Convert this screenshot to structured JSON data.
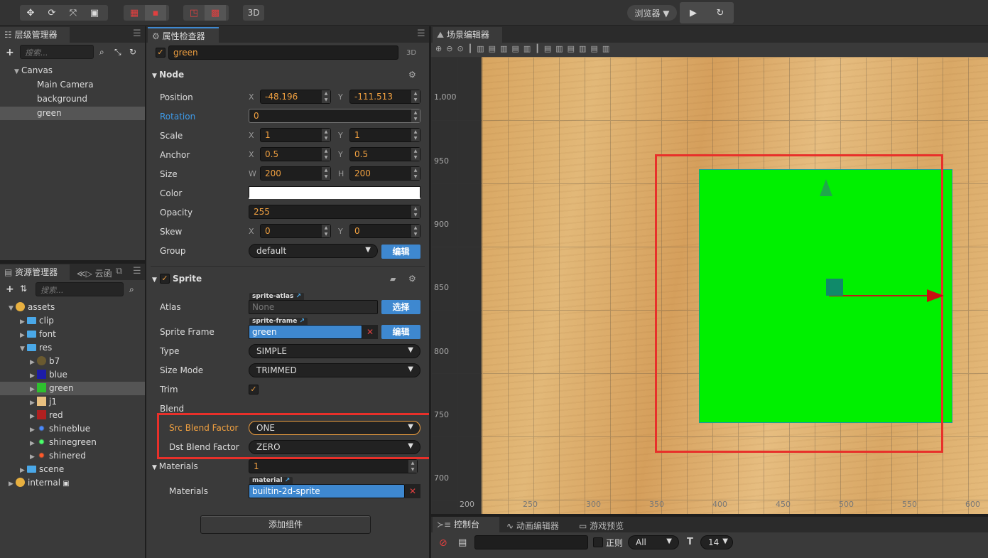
{
  "toolbar": {
    "mode_3d": "3D",
    "browser": "浏览器 ▼",
    "play": "▶",
    "refresh": "↻"
  },
  "hierarchy": {
    "title": "层级管理器",
    "search_placeholder": "搜索...",
    "nodes": [
      "Canvas",
      "Main Camera",
      "background",
      "green"
    ]
  },
  "assets": {
    "title": "资源管理器",
    "cloud_tab": "云函",
    "search_placeholder": "搜索...",
    "items": [
      {
        "label": "assets"
      },
      {
        "label": "clip"
      },
      {
        "label": "font"
      },
      {
        "label": "res"
      },
      {
        "label": "b7"
      },
      {
        "label": "blue"
      },
      {
        "label": "green"
      },
      {
        "label": "j1"
      },
      {
        "label": "red"
      },
      {
        "label": "shineblue"
      },
      {
        "label": "shinegreen"
      },
      {
        "label": "shinered"
      },
      {
        "label": "scene"
      },
      {
        "label": "internal"
      }
    ]
  },
  "inspector": {
    "title": "属性检查器",
    "node_name": "green",
    "mode_3d": "3D",
    "node_section": "Node",
    "position_label": "Position",
    "position_x": "-48.196",
    "position_y": "-111.513",
    "rotation_label": "Rotation",
    "rotation": "0",
    "scale_label": "Scale",
    "scale_x": "1",
    "scale_y": "1",
    "anchor_label": "Anchor",
    "anchor_x": "0.5",
    "anchor_y": "0.5",
    "size_label": "Size",
    "size_w": "200",
    "size_h": "200",
    "color_label": "Color",
    "opacity_label": "Opacity",
    "opacity": "255",
    "skew_label": "Skew",
    "skew_x": "0",
    "skew_y": "0",
    "group_label": "Group",
    "group": "default",
    "edit": "编辑",
    "axis_x": "X",
    "axis_y": "Y",
    "axis_w": "W",
    "axis_h": "H",
    "sprite_section": "Sprite",
    "atlas_label": "Atlas",
    "atlas_tag": "sprite-atlas",
    "atlas_value": "None",
    "choose": "选择",
    "sprite_frame_label": "Sprite Frame",
    "sprite_frame_tag": "sprite-frame",
    "sprite_frame_value": "green",
    "type_label": "Type",
    "type_value": "SIMPLE",
    "size_mode_label": "Size Mode",
    "size_mode_value": "TRIMMED",
    "trim_label": "Trim",
    "blend_label": "Blend",
    "src_blend_label": "Src Blend Factor",
    "src_blend_value": "ONE",
    "dst_blend_label": "Dst Blend Factor",
    "dst_blend_value": "ZERO",
    "materials_label": "Materials",
    "materials_count": "1",
    "material_tag": "material",
    "materials_item_label": "Materials",
    "material_value": "builtin-2d-sprite",
    "add_component": "添加组件"
  },
  "scene": {
    "title": "场景编辑器",
    "y_ticks": [
      "1,000",
      "950",
      "900",
      "850",
      "800",
      "750",
      "700"
    ],
    "x_ticks": [
      "200",
      "250",
      "300",
      "350",
      "400",
      "450",
      "500",
      "550",
      "600"
    ]
  },
  "console": {
    "tab_console": "控制台",
    "tab_animation": "动画编辑器",
    "tab_preview": "游戏预览",
    "regex": "正则",
    "filter": "All",
    "font_size": "14"
  },
  "colors": {
    "accent": "#3e88d0",
    "highlight": "#e8302a",
    "orange": "#f0a040",
    "sprite_green": "#00f000"
  }
}
